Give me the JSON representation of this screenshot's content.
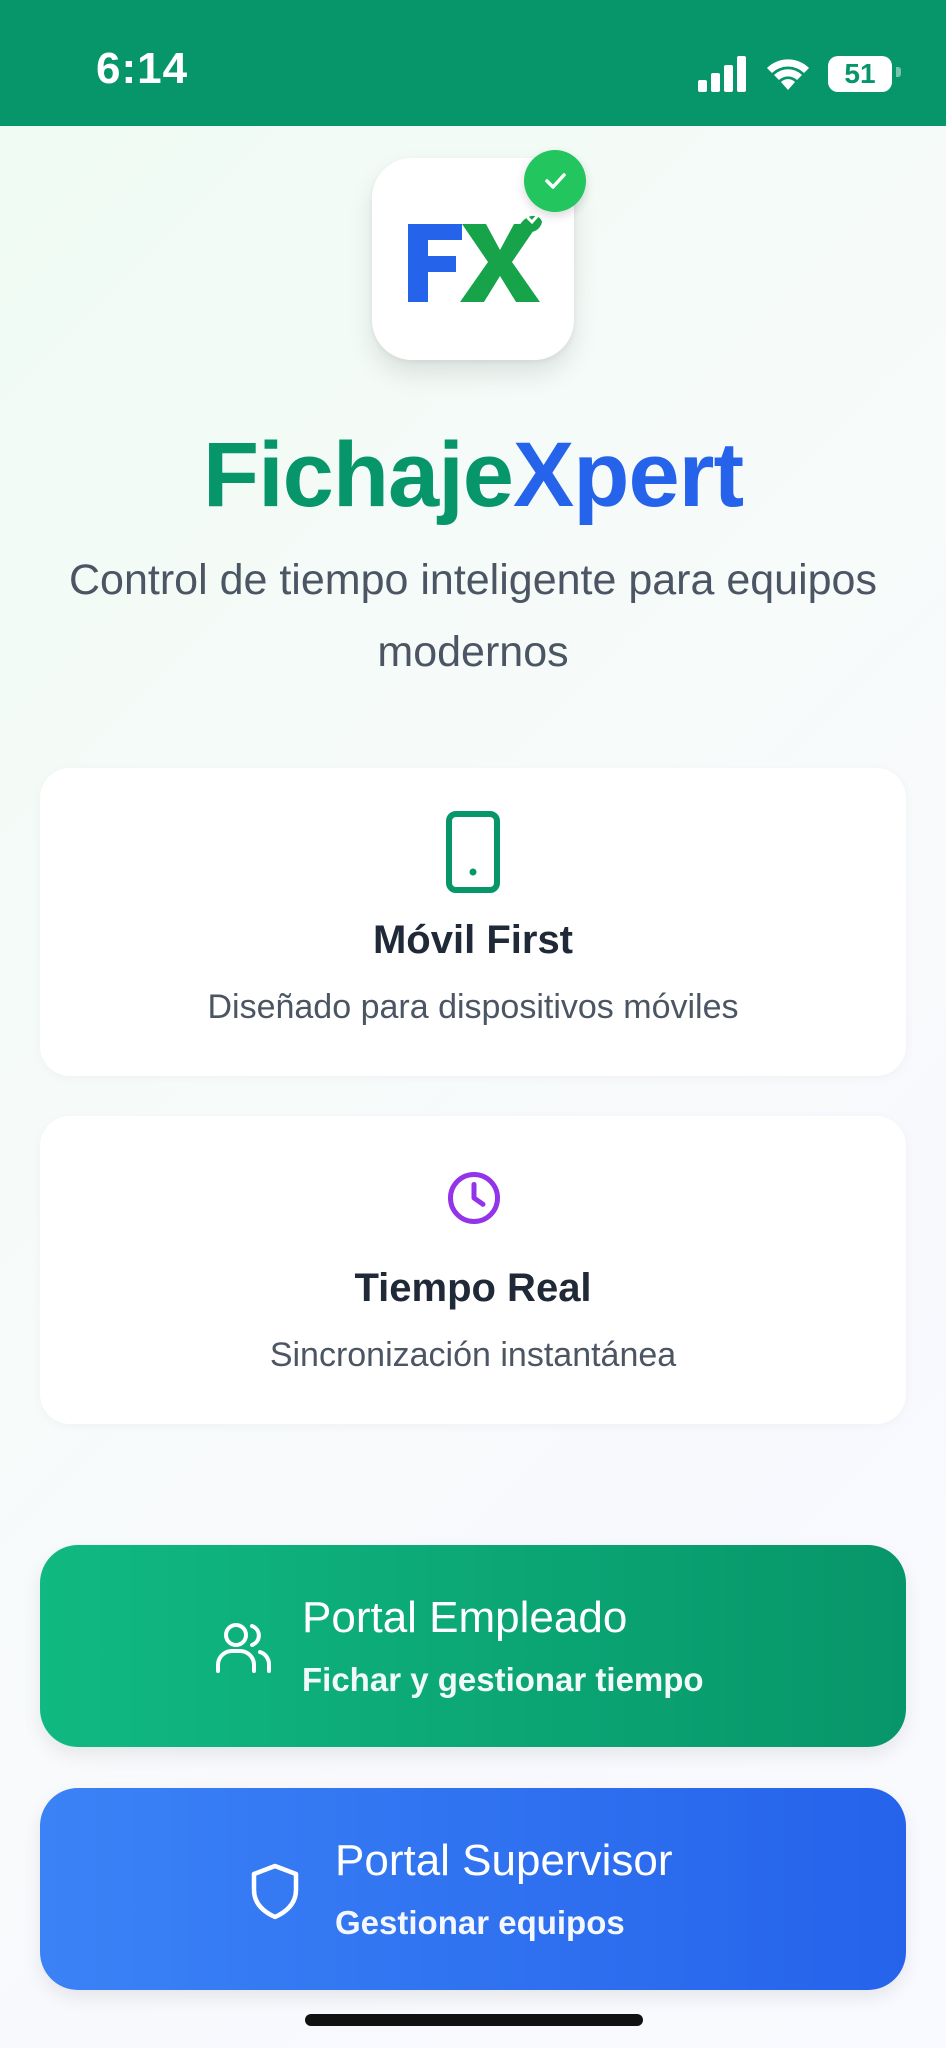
{
  "status_bar": {
    "time": "6:14",
    "battery": "51",
    "icons": [
      "signal-icon",
      "wifi-icon",
      "battery-icon"
    ]
  },
  "app": {
    "logo_text": "FX",
    "title_part1": "Fichaje",
    "title_part2": "Xpert",
    "tagline": "Control de tiempo inteligente para equipos modernos"
  },
  "features": [
    {
      "icon": "smartphone-icon",
      "title": "Móvil First",
      "subtitle": "Diseñado para dispositivos móviles"
    },
    {
      "icon": "clock-icon",
      "title": "Tiempo Real",
      "subtitle": "Sincronización instantánea"
    }
  ],
  "portals": {
    "employee": {
      "icon": "users-icon",
      "title": "Portal Empleado",
      "subtitle": "Fichar y gestionar tiempo"
    },
    "supervisor": {
      "icon": "shield-icon",
      "title": "Portal Supervisor",
      "subtitle": "Gestionar equipos"
    }
  },
  "colors": {
    "brand_green": "#079669",
    "brand_blue": "#2563eb",
    "badge_green": "#22c55e",
    "clock_purple": "#9333ea"
  }
}
